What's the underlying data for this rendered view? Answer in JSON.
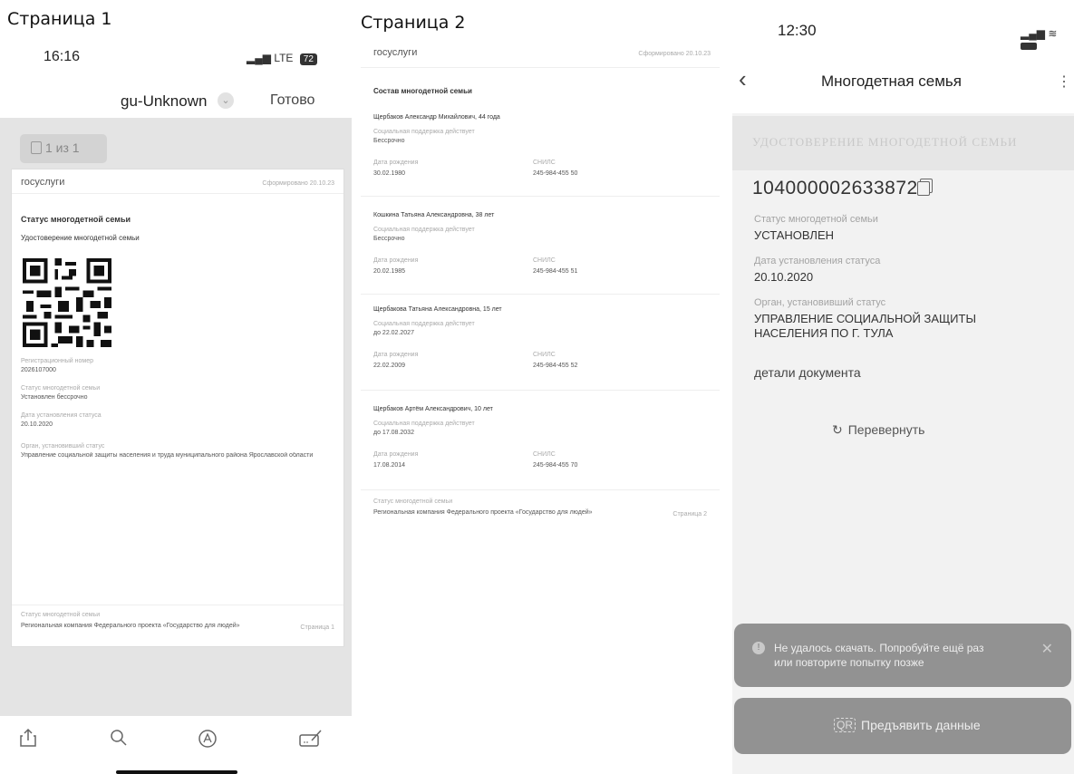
{
  "labels": {
    "page1": "Страница 1",
    "page2": "Страница 2"
  },
  "phone1": {
    "time": "16:16",
    "network": "LTE",
    "battery": "72",
    "doc_title": "gu-Unknown",
    "done": "Готово",
    "pager": "1 из 1",
    "brand": "госуслуги",
    "stamp": "Сформировано 20.10.23",
    "heading": "Статус многодетной семьи",
    "subheading": "Удостоверение многодетной семьи",
    "fields": [
      {
        "label": "Регистрационный номер",
        "value": "2026107000"
      },
      {
        "label": "Статус многодетной семьи",
        "value": "Установлен бессрочно"
      },
      {
        "label": "Дата установления статуса",
        "value": "20.10.2020"
      },
      {
        "label": "Орган, установивший статус",
        "value": "Управление социальной защиты населения и труда муниципального района Ярославской области"
      }
    ],
    "footer_label": "Статус многодетной семьи",
    "footer_text": "Региональная компания Федерального проекта «Государство для людей»",
    "footer_page": "Страница 1"
  },
  "page2": {
    "brand": "госуслуги",
    "stamp": "Сформировано 20.10.23",
    "title": "Состав многодетной семьи",
    "members": [
      {
        "name": "Щербаков Александр Михайлович, 44 года",
        "support_label": "Социальная поддержка действует",
        "support": "Бессрочно",
        "dob_label": "Дата рождения",
        "dob": "30.02.1980",
        "snils_label": "СНИЛС",
        "snils": "245-984-455 50"
      },
      {
        "name": "Кошкина Татьяна Александровна, 38 лет",
        "support_label": "Социальная поддержка действует",
        "support": "Бессрочно",
        "dob_label": "Дата рождения",
        "dob": "20.02.1985",
        "snils_label": "СНИЛС",
        "snils": "245-984-455 51"
      },
      {
        "name": "Щербакова Татьяна Александровна, 15 лет",
        "support_label": "Социальная поддержка действует",
        "support": "до 22.02.2027",
        "dob_label": "Дата рождения",
        "dob": "22.02.2009",
        "snils_label": "СНИЛС",
        "snils": "245-984-455 52"
      },
      {
        "name": "Щербаков Артём Александрович, 10 лет",
        "support_label": "Социальная поддержка действует",
        "support": "до 17.08.2032",
        "dob_label": "Дата рождения",
        "dob": "17.08.2014",
        "snils_label": "СНИЛС",
        "snils": "245-984-455 70"
      }
    ],
    "footer_label": "Статус многодетной семьи",
    "footer_text": "Региональная компания Федерального проекта «Государство для людей»",
    "footer_page": "Страница 2"
  },
  "phone3": {
    "time": "12:30",
    "title": "Многодетная семья",
    "card_header": "УДОСТОВЕРЕНИЕ МНОГОДЕТНОЙ СЕМЬИ",
    "number": "104000002633872",
    "status_label": "Статус многодетной семьи",
    "status_value": "УСТАНОВЛЕН",
    "date_label": "Дата установления статуса",
    "date_value": "20.10.2020",
    "organ_label": "Орган, установивший статус",
    "organ_value_line1": "УПРАВЛЕНИЕ СОЦИАЛЬНОЙ ЗАЩИТЫ",
    "organ_value_line2": "НАСЕЛЕНИЯ ПО Г. ТУЛА",
    "details": "детали документа",
    "flip": "Перевернуть",
    "toast_line1": "Не удалось скачать. Попробуйте ещё раз",
    "toast_line2": "или повторите попытку позже",
    "present": "Предъявить данные"
  },
  "colors": {
    "toast_bg": "#929292",
    "card_header_bg": "#e6e6e6",
    "viewer_bg": "#e4e4e4"
  }
}
